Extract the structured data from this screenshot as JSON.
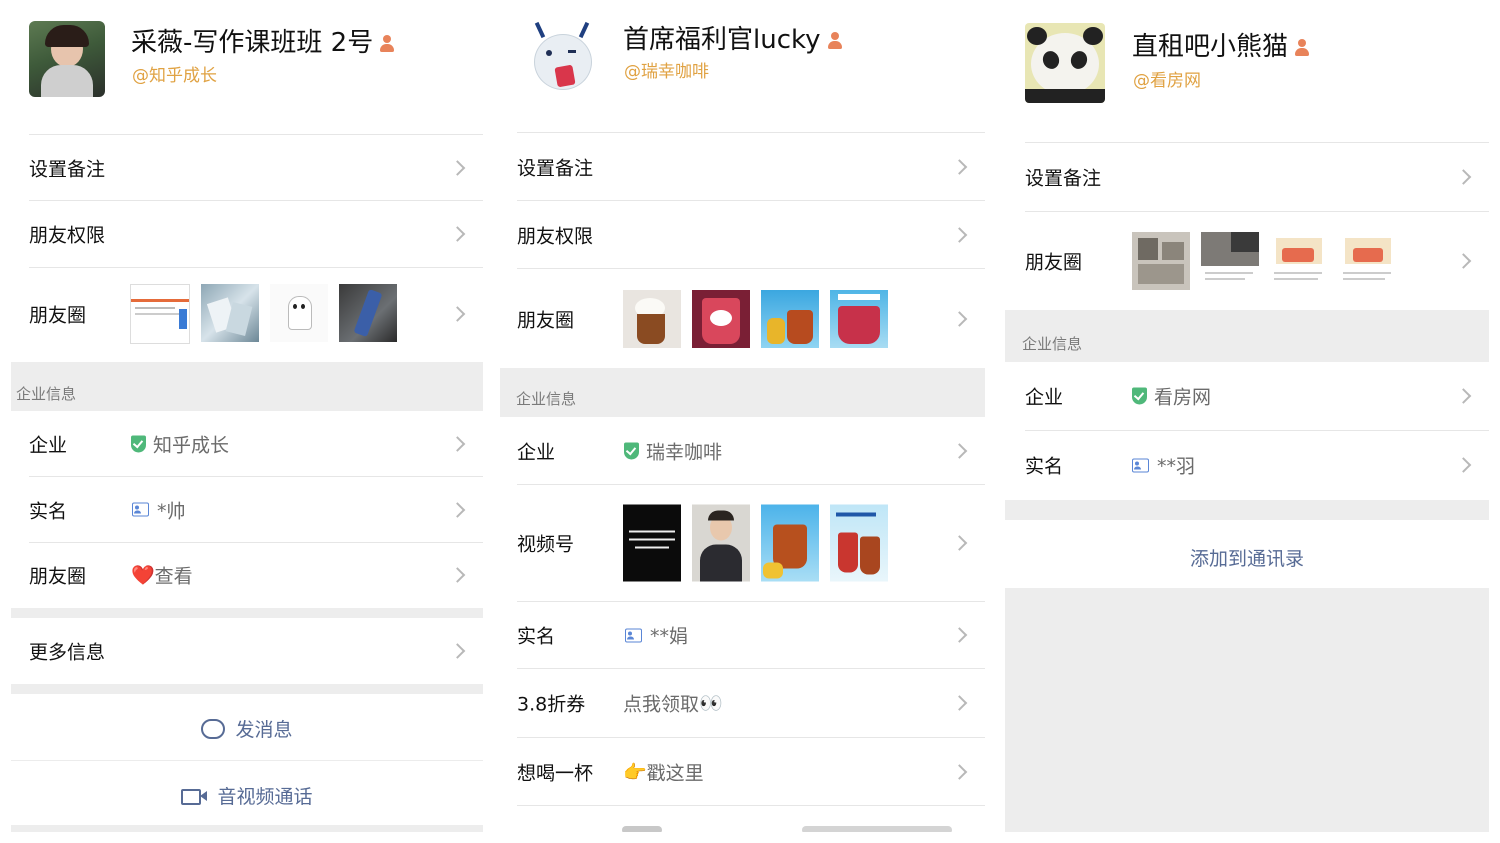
{
  "panel1": {
    "name": "采薇-写作课班班 2号",
    "corp_handle": "@知乎成长",
    "rows": {
      "remark": "设置备注",
      "permission": "朋友权限",
      "moments": "朋友圈"
    },
    "section_title": "企业信息",
    "company_label": "企业",
    "company_value": "知乎成长",
    "realname_label": "实名",
    "realname_value": "*帅",
    "moments2_label": "朋友圈",
    "moments2_heart": "❤️",
    "moments2_value": "查看",
    "more_info": "更多信息",
    "send_message": "发消息",
    "av_call": "音视频通话"
  },
  "panel2": {
    "name": "首席福利官lucky",
    "corp_handle": "@瑞幸咖啡",
    "rows": {
      "remark": "设置备注",
      "permission": "朋友权限",
      "moments": "朋友圈"
    },
    "section_title": "企业信息",
    "company_label": "企业",
    "company_value": "瑞幸咖啡",
    "channels_label": "视频号",
    "realname_label": "实名",
    "realname_value": "**娟",
    "coupon_label": "3.8折券",
    "coupon_value": "点我领取",
    "coupon_emoji": "👀",
    "drink_label": "想喝一杯",
    "drink_emoji": "👉",
    "drink_value": "戳这里"
  },
  "panel3": {
    "name": "直租吧小熊猫",
    "corp_handle": "@看房网",
    "rows": {
      "remark": "设置备注",
      "moments": "朋友圈"
    },
    "section_title": "企业信息",
    "company_label": "企业",
    "company_value": "看房网",
    "realname_label": "实名",
    "realname_value": "**羽",
    "add_contact": "添加到通讯录"
  },
  "colors": {
    "link": "#576b95",
    "handle": "#e0a243",
    "verified": "#4fb87a",
    "divider": "#ededed"
  }
}
